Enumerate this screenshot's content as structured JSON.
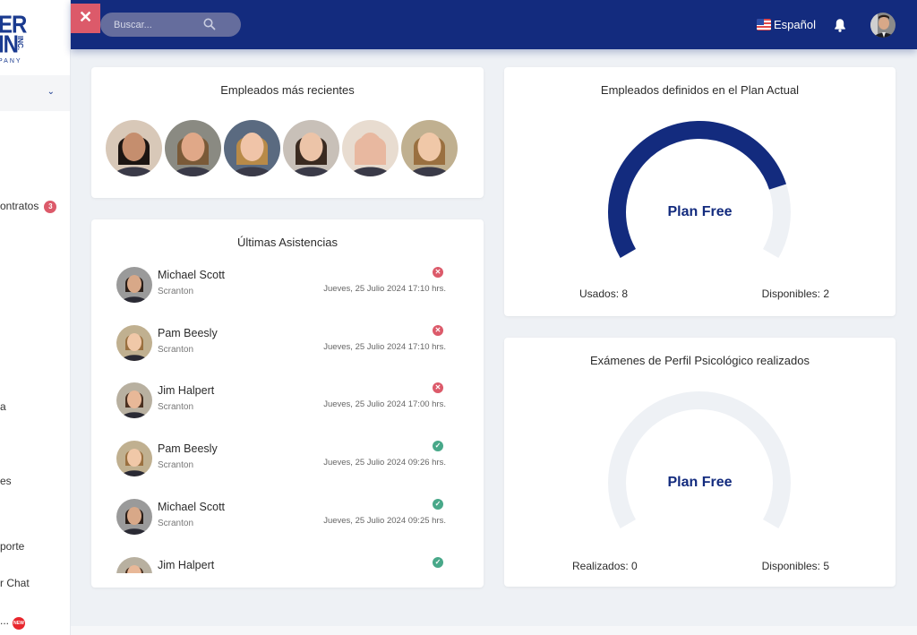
{
  "sidebar": {
    "logo": {
      "line1": "ER",
      "line2": "IN",
      "inc": "INC.",
      "company": "PANY"
    },
    "items": [
      {
        "label": "ontratos",
        "badge": "3"
      },
      {
        "label": "a"
      },
      {
        "label": "es"
      },
      {
        "label": "porte"
      },
      {
        "label": "r Chat"
      },
      {
        "label": "...",
        "badge_new": "NEW"
      }
    ]
  },
  "topbar": {
    "search_placeholder": "Buscar...",
    "language": "Español"
  },
  "recent_employees": {
    "title": "Empleados más recientes",
    "faces": [
      {
        "skin": "#c58e6e",
        "hair": "#1c1512",
        "bg": "#d8c8b8"
      },
      {
        "skin": "#e0a888",
        "hair": "#7a5a38",
        "bg": "#8a8a82"
      },
      {
        "skin": "#f0c4a8",
        "hair": "#b88a48",
        "bg": "#5a6a80"
      },
      {
        "skin": "#ecc4a8",
        "hair": "#3a2a20",
        "bg": "#c8c0b8"
      },
      {
        "skin": "#e8b8a0",
        "hair": "#e8b8a0",
        "bg": "#e8dcd0"
      },
      {
        "skin": "#f0c8a8",
        "hair": "#9a7040",
        "bg": "#c0b090"
      }
    ]
  },
  "attendance": {
    "title": "Últimas Asistencias",
    "rows": [
      {
        "name": "Michael Scott",
        "location": "Scranton",
        "date": "Jueves, 25 Julio 2024 17:10 hrs.",
        "status": "fail"
      },
      {
        "name": "Pam Beesly",
        "location": "Scranton",
        "date": "Jueves, 25 Julio 2024 17:10 hrs.",
        "status": "fail"
      },
      {
        "name": "Jim Halpert",
        "location": "Scranton",
        "date": "Jueves, 25 Julio 2024 17:00 hrs.",
        "status": "fail"
      },
      {
        "name": "Pam Beesly",
        "location": "Scranton",
        "date": "Jueves, 25 Julio 2024 09:26 hrs.",
        "status": "ok"
      },
      {
        "name": "Michael Scott",
        "location": "Scranton",
        "date": "Jueves, 25 Julio 2024 09:25 hrs.",
        "status": "ok"
      },
      {
        "name": "Jim Halpert",
        "location": "",
        "date": "",
        "status": "ok"
      }
    ],
    "status_icons": {
      "fail": "✕",
      "ok": "✓"
    }
  },
  "plan_card": {
    "title": "Empleados definidos en el Plan Actual",
    "center_label": "Plan Free",
    "used_label": "Usados: 8",
    "available_label": "Disponibles: 2",
    "used": 8,
    "available": 2
  },
  "exams_card": {
    "title": "Exámenes de Perfil Psicológico realizados",
    "center_label": "Plan Free",
    "done_label": "Realizados: 0",
    "available_label": "Disponibles: 5",
    "done": 0,
    "available": 5
  },
  "colors": {
    "primary": "#132b7e",
    "danger": "#dc5a6a",
    "success": "#48a889",
    "track": "#eef1f5"
  }
}
